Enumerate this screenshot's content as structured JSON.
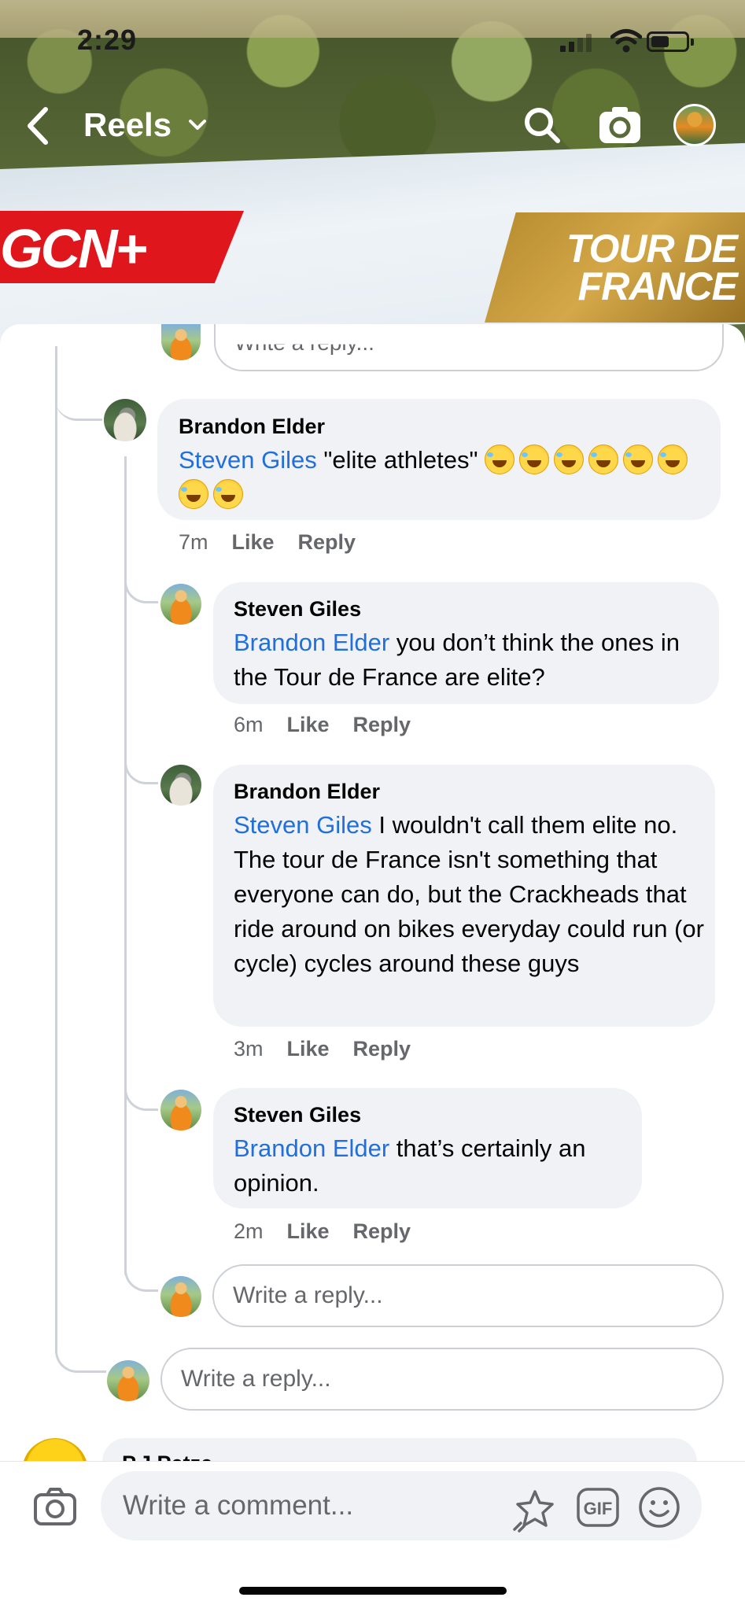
{
  "status_bar": {
    "time": "2:29"
  },
  "header": {
    "title": "Reels",
    "overlay_left": "GCN+",
    "overlay_right": "TOUR DE FRANCE"
  },
  "top_reply_placeholder": "Write a reply...",
  "comments": [
    {
      "author": "Brandon Elder",
      "mention": "Steven Giles",
      "text": " \"elite athletes\" ",
      "emoji_count": 8,
      "emoji": "rolling-on-floor-laughing",
      "time": "7m",
      "like": "Like",
      "reply": "Reply"
    },
    {
      "author": "Steven Giles",
      "mention": "Brandon Elder",
      "text": " you don’t think the ones in the Tour de France are elite?",
      "time": "6m",
      "like": "Like",
      "reply": "Reply"
    },
    {
      "author": "Brandon Elder",
      "mention": "Steven Giles",
      "text": " I wouldn't call them elite no. The tour de France isn't something that everyone can do, but the Crackheads that ride around on bikes everyday could run (or cycle) cycles around these guys",
      "time": "3m",
      "like": "Like",
      "reply": "Reply"
    },
    {
      "author": "Steven Giles",
      "mention": "Brandon Elder",
      "text": " that’s certainly an opinion.",
      "time": "2m",
      "like": "Like",
      "reply": "Reply"
    }
  ],
  "reply_inputs": {
    "nested_placeholder": "Write a reply...",
    "thread_placeholder": "Write a reply..."
  },
  "next_comment_author_partial": "P.J Petze",
  "composer": {
    "placeholder": "Write a comment...",
    "gif_label": "GIF"
  },
  "colors": {
    "mention": "#216fdb",
    "bubble": "#f0f2f5",
    "meta": "#65676b"
  }
}
